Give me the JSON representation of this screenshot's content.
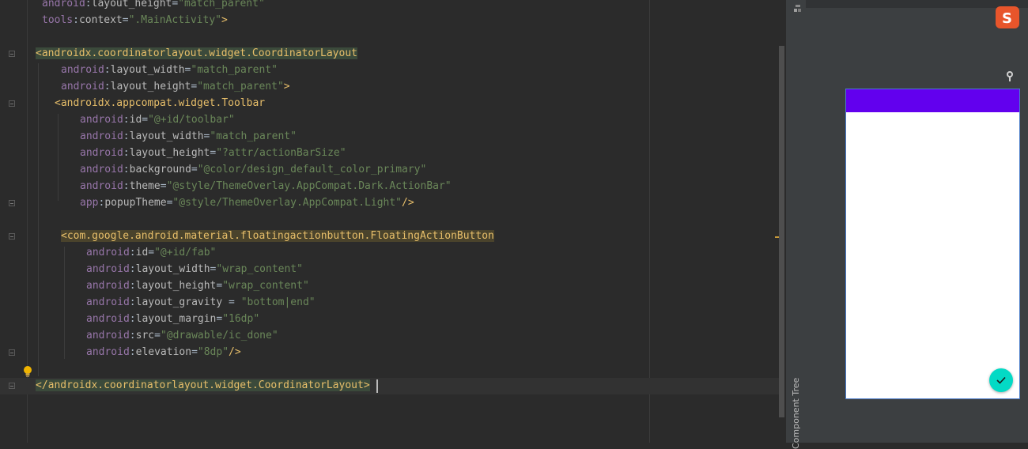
{
  "editor": {
    "lines": [
      [
        {
          "c": "ns",
          "t": "android"
        },
        {
          "c": "eq",
          "t": ":"
        },
        {
          "c": "attr",
          "t": "layout_height"
        },
        {
          "c": "eq",
          "t": "="
        },
        {
          "c": "val",
          "t": "\"match_parent\""
        }
      ],
      [
        {
          "c": "ns",
          "t": "tools"
        },
        {
          "c": "eq",
          "t": ":"
        },
        {
          "c": "attr",
          "t": "context"
        },
        {
          "c": "eq",
          "t": "="
        },
        {
          "c": "val",
          "t": "\".MainActivity\""
        },
        {
          "c": "bracket",
          "t": ">"
        }
      ],
      [],
      [
        {
          "c": "bracket",
          "t": "<androidx.coordinatorlayout.widget.CoordinatorLayout"
        }
      ],
      [
        {
          "c": "ns",
          "t": "android"
        },
        {
          "c": "eq",
          "t": ":"
        },
        {
          "c": "attr",
          "t": "layout_width"
        },
        {
          "c": "eq",
          "t": "="
        },
        {
          "c": "val",
          "t": "\"match_parent\""
        }
      ],
      [
        {
          "c": "ns",
          "t": "android"
        },
        {
          "c": "eq",
          "t": ":"
        },
        {
          "c": "attr",
          "t": "layout_height"
        },
        {
          "c": "eq",
          "t": "="
        },
        {
          "c": "val",
          "t": "\"match_parent\""
        },
        {
          "c": "bracket",
          "t": ">"
        }
      ],
      [
        {
          "c": "bracket",
          "t": "<androidx.appcompat.widget.Toolbar"
        }
      ],
      [
        {
          "c": "ns",
          "t": "android"
        },
        {
          "c": "eq",
          "t": ":"
        },
        {
          "c": "attr",
          "t": "id"
        },
        {
          "c": "eq",
          "t": "="
        },
        {
          "c": "val",
          "t": "\"@+id/toolbar\""
        }
      ],
      [
        {
          "c": "ns",
          "t": "android"
        },
        {
          "c": "eq",
          "t": ":"
        },
        {
          "c": "attr",
          "t": "layout_width"
        },
        {
          "c": "eq",
          "t": "="
        },
        {
          "c": "val",
          "t": "\"match_parent\""
        }
      ],
      [
        {
          "c": "ns",
          "t": "android"
        },
        {
          "c": "eq",
          "t": ":"
        },
        {
          "c": "attr",
          "t": "layout_height"
        },
        {
          "c": "eq",
          "t": "="
        },
        {
          "c": "val",
          "t": "\"?attr/actionBarSize\""
        }
      ],
      [
        {
          "c": "ns",
          "t": "android"
        },
        {
          "c": "eq",
          "t": ":"
        },
        {
          "c": "attr",
          "t": "background"
        },
        {
          "c": "eq",
          "t": "="
        },
        {
          "c": "val",
          "t": "\"@color/design_default_color_primary\""
        }
      ],
      [
        {
          "c": "ns",
          "t": "android"
        },
        {
          "c": "eq",
          "t": ":"
        },
        {
          "c": "attr",
          "t": "theme"
        },
        {
          "c": "eq",
          "t": "="
        },
        {
          "c": "val",
          "t": "\"@style/ThemeOverlay.AppCompat.Dark.ActionBar\""
        }
      ],
      [
        {
          "c": "ns",
          "t": "app"
        },
        {
          "c": "eq",
          "t": ":"
        },
        {
          "c": "attr",
          "t": "popupTheme"
        },
        {
          "c": "eq",
          "t": "="
        },
        {
          "c": "val",
          "t": "\"@style/ThemeOverlay.AppCompat.Light\""
        },
        {
          "c": "bracket",
          "t": "/>"
        }
      ],
      [],
      [
        {
          "c": "bracket",
          "t": "<com.google.android.material.floatingactionbutton.FloatingActionButton"
        }
      ],
      [
        {
          "c": "ns",
          "t": "android"
        },
        {
          "c": "eq",
          "t": ":"
        },
        {
          "c": "attr",
          "t": "id"
        },
        {
          "c": "eq",
          "t": "="
        },
        {
          "c": "val",
          "t": "\"@+id/fab\""
        }
      ],
      [
        {
          "c": "ns",
          "t": "android"
        },
        {
          "c": "eq",
          "t": ":"
        },
        {
          "c": "attr",
          "t": "layout_width"
        },
        {
          "c": "eq",
          "t": "="
        },
        {
          "c": "val",
          "t": "\"wrap_content\""
        }
      ],
      [
        {
          "c": "ns",
          "t": "android"
        },
        {
          "c": "eq",
          "t": ":"
        },
        {
          "c": "attr",
          "t": "layout_height"
        },
        {
          "c": "eq",
          "t": "="
        },
        {
          "c": "val",
          "t": "\"wrap_content\""
        }
      ],
      [
        {
          "c": "ns",
          "t": "android"
        },
        {
          "c": "eq",
          "t": ":"
        },
        {
          "c": "attr",
          "t": "layout_gravity"
        },
        {
          "c": "eq",
          "t": " = "
        },
        {
          "c": "val",
          "t": "\"bottom|end\""
        }
      ],
      [
        {
          "c": "ns",
          "t": "android"
        },
        {
          "c": "eq",
          "t": ":"
        },
        {
          "c": "attr",
          "t": "layout_margin"
        },
        {
          "c": "eq",
          "t": "="
        },
        {
          "c": "val",
          "t": "\"16dp\""
        }
      ],
      [
        {
          "c": "ns",
          "t": "android"
        },
        {
          "c": "eq",
          "t": ":"
        },
        {
          "c": "attr",
          "t": "src"
        },
        {
          "c": "eq",
          "t": "="
        },
        {
          "c": "val",
          "t": "\"@drawable/ic_done\""
        }
      ],
      [
        {
          "c": "ns",
          "t": "android"
        },
        {
          "c": "eq",
          "t": ":"
        },
        {
          "c": "attr",
          "t": "elevation"
        },
        {
          "c": "eq",
          "t": "="
        },
        {
          "c": "val",
          "t": "\"8dp\""
        },
        {
          "c": "bracket",
          "t": "/>"
        }
      ],
      [],
      [
        {
          "c": "bracket",
          "t": "</androidx.coordinatorlayout.widget.CoordinatorLayout>"
        }
      ]
    ]
  },
  "side_panel": {
    "component_tree_label": "Component Tree"
  },
  "preview": {
    "toolbar_color": "#6200ee",
    "fab_color": "#03dac5",
    "fab_icon": "check-icon",
    "logo_letter": "S"
  },
  "colors": {
    "tag": "#e8bf6a",
    "namespace": "#9876aa",
    "attribute": "#bababa",
    "value": "#6a8759",
    "background": "#2b2b2b"
  }
}
